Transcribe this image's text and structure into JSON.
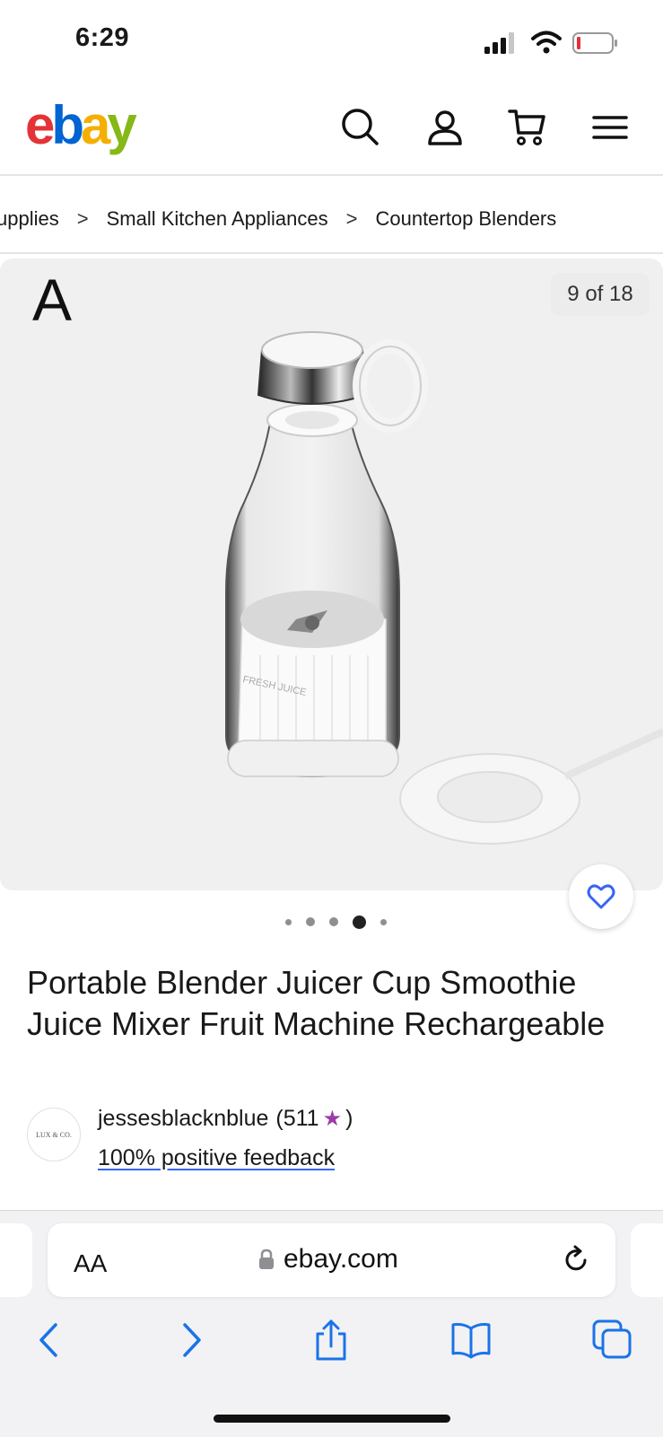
{
  "status": {
    "time": "6:29",
    "battery_color": "#e53238"
  },
  "header": {
    "logo_letters": [
      "e",
      "b",
      "a",
      "y"
    ],
    "icons": [
      "search-icon",
      "account-icon",
      "cart-icon",
      "menu-icon"
    ]
  },
  "breadcrumb": {
    "items": [
      "upplies",
      "Small Kitchen Appliances",
      "Countertop Blenders"
    ],
    "separator": ">"
  },
  "gallery": {
    "brand_letter": "A",
    "counter": "9 of 18",
    "total_dots": 5,
    "active_dot_index": 3,
    "label_text": "FRESH JUICE"
  },
  "listing": {
    "title": "Portable Blender Juicer Cup Smoothie Juice Mixer Fruit Machine Rechargeable"
  },
  "seller": {
    "avatar_text": "LUX & CO.",
    "name": "jessesblacknblue",
    "score_open": "(511",
    "score_close": ")",
    "feedback": "100% positive feedback"
  },
  "browser": {
    "text_size_button": "AA",
    "url": "ebay.com",
    "toolbar": [
      "back-icon",
      "forward-icon",
      "share-icon",
      "bookmarks-icon",
      "tabs-icon"
    ],
    "accent_color": "#1a73e8"
  }
}
